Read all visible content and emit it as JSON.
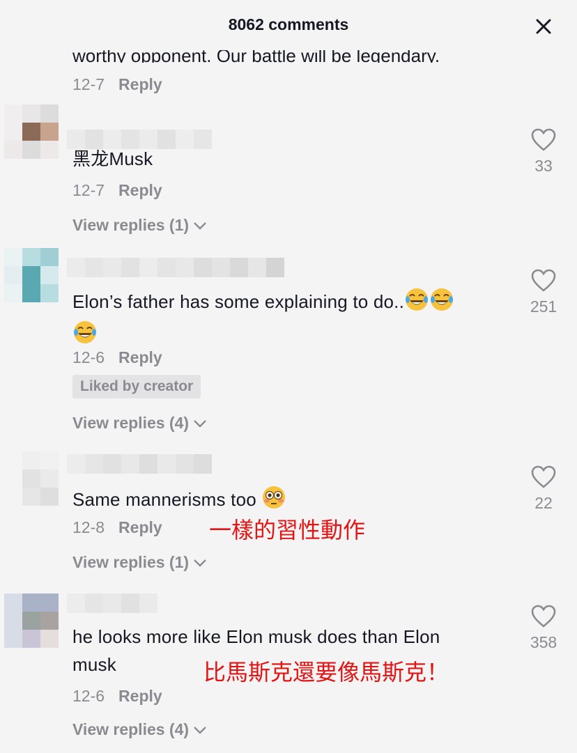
{
  "header": {
    "title": "8062 comments",
    "close_icon": "close-icon"
  },
  "clipped_comment": {
    "text": "worthy opponent. Our battle will be legendary.",
    "date": "12-7",
    "reply": "Reply"
  },
  "comments": [
    {
      "text": "黑龙Musk",
      "date": "12-7",
      "reply": "Reply",
      "view_replies": "View replies (1)",
      "likes": "33",
      "avatar_colors": [
        "#f0eeee",
        "#e8e6e6",
        "#dcdcdc",
        "#8c6a58",
        "#c8a48e",
        "#ece9e8"
      ]
    },
    {
      "text": "Elon’s father has some explaining to do..",
      "date": "12-6",
      "reply": "Reply",
      "badge": "Liked by creator",
      "view_replies": "View replies (4)",
      "likes": "251",
      "emoji": [
        "face-with-tears-of-joy-icon",
        "face-with-tears-of-joy-icon",
        "face-with-tears-of-joy-icon"
      ],
      "avatar_colors": [
        "#e4eef0",
        "#b8dde0",
        "#9fcfd4",
        "#5aa8b2",
        "#d6e9ec",
        "#eaf2f3"
      ]
    },
    {
      "text": "Same mannerisms too",
      "date": "12-8",
      "reply": "Reply",
      "view_replies": "View replies (1)",
      "likes": "22",
      "emoji": [
        "flushed-face-icon"
      ],
      "annotation": "一樣的習性動作",
      "avatar_colors": [
        "#efefef",
        "#e2e2e2",
        "#eaeaea",
        "#dedede",
        "#f1f1f1",
        "#e6e6e6"
      ]
    },
    {
      "text_line1": "he looks more like Elon musk does than Elon",
      "text_line2": "musk",
      "date": "12-6",
      "reply": "Reply",
      "view_replies": "View replies (4)",
      "likes": "358",
      "annotation": "比馬斯克還要像馬斯克！",
      "avatar_colors": [
        "#d8dce6",
        "#aab2c8",
        "#9aa3a0",
        "#a8a2a0",
        "#c9c4d6",
        "#e6dedc"
      ]
    }
  ]
}
